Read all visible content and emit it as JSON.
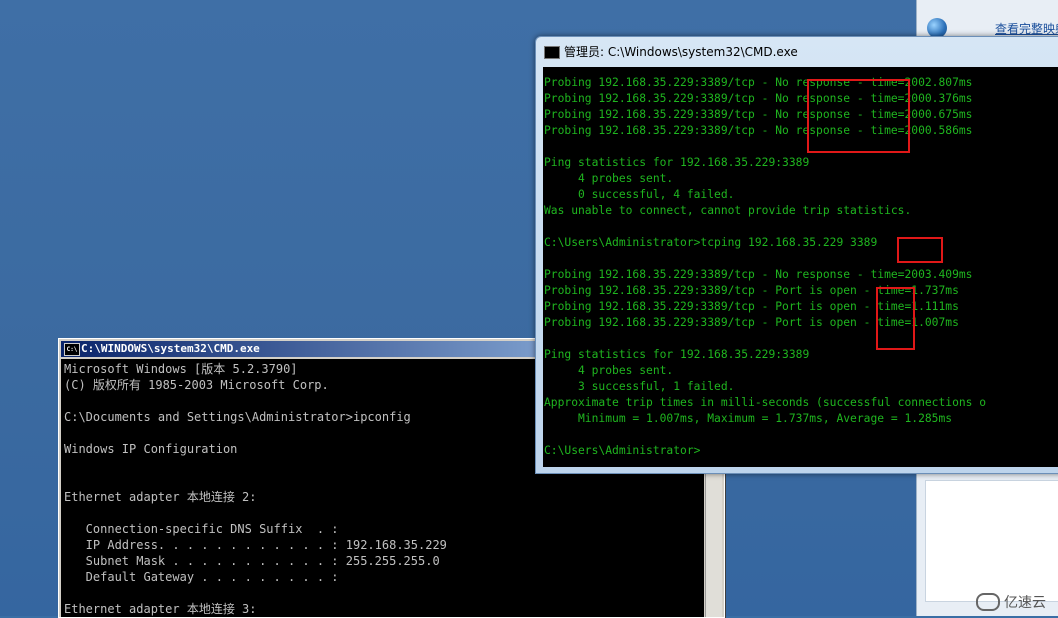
{
  "right_window": {
    "link_text": "查看完整映射",
    "footer_text": "...................."
  },
  "watermark": {
    "text": "亿速云"
  },
  "xp_window": {
    "title": "C:\\WINDOWS\\system32\\CMD.exe",
    "lines": [
      "Microsoft Windows [版本 5.2.3790]",
      "(C) 版权所有 1985-2003 Microsoft Corp.",
      "",
      "C:\\Documents and Settings\\Administrator>ipconfig",
      "",
      "Windows IP Configuration",
      "",
      "",
      "Ethernet adapter 本地连接 2:",
      "",
      "   Connection-specific DNS Suffix  . :",
      "   IP Address. . . . . . . . . . . . : 192.168.35.229",
      "   Subnet Mask . . . . . . . . . . . : 255.255.255.0",
      "   Default Gateway . . . . . . . . . :",
      "",
      "Ethernet adapter 本地连接 3:"
    ]
  },
  "win7_window": {
    "title": "管理员: C:\\Windows\\system32\\CMD.exe",
    "lines": [
      "Probing 192.168.35.229:3389/tcp - No response - time=2002.807ms",
      "Probing 192.168.35.229:3389/tcp - No response - time=2000.376ms",
      "Probing 192.168.35.229:3389/tcp - No response - time=2000.675ms",
      "Probing 192.168.35.229:3389/tcp - No response - time=2000.586ms",
      "",
      "Ping statistics for 192.168.35.229:3389",
      "     4 probes sent.",
      "     0 successful, 4 failed.",
      "Was unable to connect, cannot provide trip statistics.",
      "",
      "C:\\Users\\Administrator>tcping 192.168.35.229 3389",
      "",
      "Probing 192.168.35.229:3389/tcp - No response - time=2003.409ms",
      "Probing 192.168.35.229:3389/tcp - Port is open - time=1.737ms",
      "Probing 192.168.35.229:3389/tcp - Port is open - time=1.111ms",
      "Probing 192.168.35.229:3389/tcp - Port is open - time=1.007ms",
      "",
      "Ping statistics for 192.168.35.229:3389",
      "     4 probes sent.",
      "     3 successful, 1 failed.",
      "Approximate trip times in milli-seconds (successful connections o",
      "     Minimum = 1.007ms, Maximum = 1.737ms, Average = 1.285ms",
      "",
      "C:\\Users\\Administrator>"
    ]
  },
  "colors": {
    "win7_text": "#1fb51f",
    "xp_text": "#c0c0c0",
    "highlight": "#e01818",
    "desktop": "#3a6ea5"
  }
}
